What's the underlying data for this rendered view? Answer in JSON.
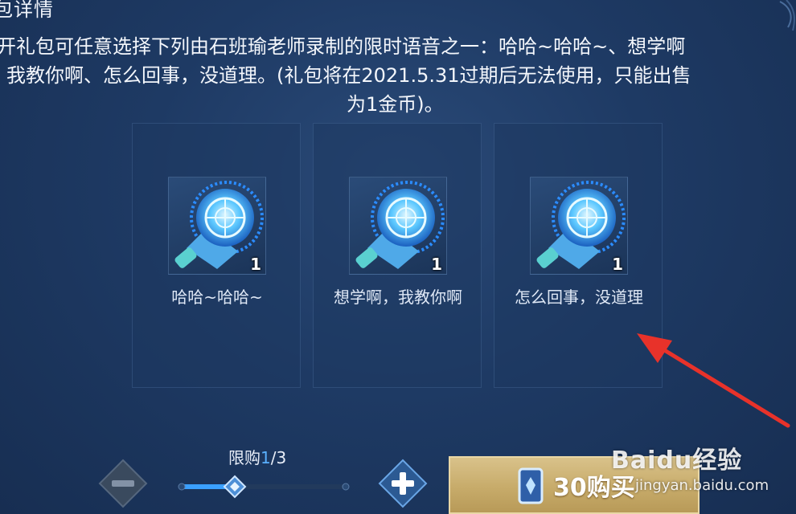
{
  "header": {
    "title": "包详情"
  },
  "description": {
    "line1": "开礼包可任意选择下列由石班瑜老师录制的限时语音之一：哈哈~哈哈~、想学啊",
    "line2": "我教你啊、怎么回事，没道理。(礼包将在2021.5.31过期后无法使用，只能出售",
    "line3": "为1金币)。"
  },
  "items": [
    {
      "label": "哈哈~哈哈~",
      "quantity": "1",
      "icon": "speaker-horn-icon"
    },
    {
      "label": "想学啊，我教你啊",
      "quantity": "1",
      "icon": "speaker-horn-icon"
    },
    {
      "label": "怎么回事，没道理",
      "quantity": "1",
      "icon": "speaker-horn-icon"
    }
  ],
  "purchase": {
    "limit_prefix": "限购",
    "limit_current": "1",
    "limit_total": "/3",
    "slider_fraction": 0.33,
    "buy_label": "30购买",
    "minus_icon": "minus-icon",
    "plus_icon": "plus-icon",
    "coupon_icon": "coupon-icon"
  },
  "watermark": {
    "brand": "Baidu经验",
    "url": "jingyan.baidu.com"
  },
  "colors": {
    "background": "#1e3a64",
    "accent_blue": "#5ab0ff",
    "buy_gold": "#c7ab6a",
    "annotation_red": "#e8322a"
  }
}
